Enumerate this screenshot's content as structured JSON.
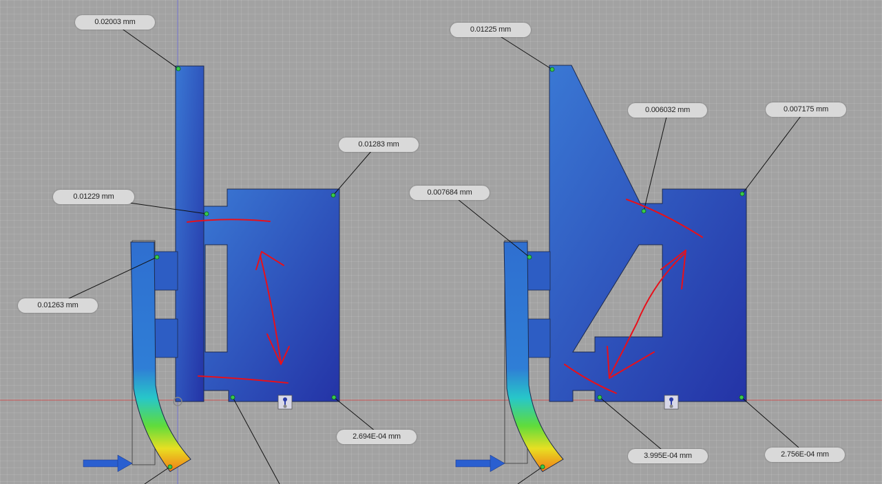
{
  "viewport": {
    "background": "#a2a2a2",
    "part_fill_dark": "#2433a6",
    "part_fill_light": "#3a78d4",
    "markup_color": "#e8101a",
    "load_arrow_color": "#2a5fd0",
    "icons": [
      "load-arrow-icon",
      "constraint-icon",
      "probe-point-icon",
      "freehand-arrow-icon"
    ]
  },
  "left_model": {
    "probes": {
      "top": "0.02003 mm",
      "upper_right": "0.01283 mm",
      "mid_left": "0.01229 mm",
      "arm": "0.01263 mm",
      "bottom_right": "2.694E-04 mm"
    }
  },
  "right_model": {
    "probes": {
      "top": "0.01225 mm",
      "notch": "0.006032 mm",
      "upper_right": "0.007175 mm",
      "arm": "0.007684 mm",
      "bottom_mid": "3.995E-04 mm",
      "bottom_right": "2.756E-04 mm"
    }
  }
}
